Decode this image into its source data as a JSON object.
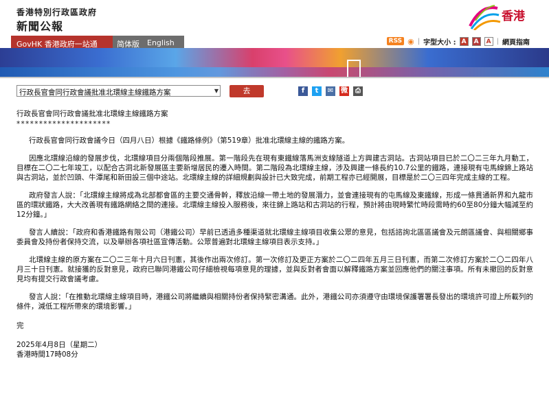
{
  "header": {
    "gov_name": "香港特別行政區政府",
    "site_name": "新聞公報",
    "brand_text": "香港"
  },
  "nav": {
    "govhk": "GovHK 香港政府一站通",
    "simplified": "简体版",
    "english": "English"
  },
  "tools": {
    "rss": "RSS",
    "font_size_label": "字型大小 :",
    "font_small": "A",
    "font_medium": "A",
    "font_large": "A",
    "guide": "網頁指南"
  },
  "selector": {
    "selected": "行政長官會同行政會議批准北環線主線鐵路方案",
    "go_label": "去"
  },
  "share": {
    "facebook": "f",
    "twitter": "t",
    "email": "✉",
    "weibo": "微",
    "print": "⎙"
  },
  "article": {
    "title": "行政長官會同行政會議批准北環線主線鐵路方案",
    "stars": "*********************",
    "paragraphs": [
      "行政長官會同行政會議今日（四月八日）根據《鐵路條例》（第519章）批准北環線主線的鐵路方案。",
      "因應北環線沿線的發展步伐，北環線項目分兩個階段推展。第一階段先在現有東鐵線落馬洲支線隧道上方興建古洞站。古洞站項目已於二〇二三年九月動工，目標在二〇二七年竣工，以配合古洞北新發展區主要新增居民的遷入時間。第二階段為北環線主線，涉及興建一條長約10.7公里的鐵路，連接現有屯馬線錦上路站與古洞站，並於凹頭、牛潭尾和新田設三個中途站。北環線主線的詳細規劃與設計已大致完成，前期工程亦已經開展，目標是於二〇三四年完成主線的工程。",
      "政府發言人說：「北環線主線將成為北部都會區的主要交通骨幹，釋放沿線一帶土地的發展潛力，並會連接現有的屯馬線及東鐵線，形成一條貫通新界和九龍市區的環狀鐵路，大大改善現有鐵路網絡之間的連接。北環線主線投入服務後，來往錦上路站和古洞站的行程，預計將由現時繁忙時段需時約60至80分鐘大幅減至約12分鐘。」",
      "發言人續說：「政府和香港鐵路有限公司（港鐵公司）早前已透過多種渠道就北環線主線項目收集公眾的意見，包括諮詢北區區議會及元朗區議會、與相關鄉事委員會及持份者保持交流，以及舉辦各項社區宣傳活動。公眾普遍對北環線主線項目表示支持。」",
      "北環線主線的原方案在二〇二三年十月六日刊憲，其後作出兩次修訂。第一次修訂及更正方案於二〇二四年五月三日刊憲，而第二次修訂方案於二〇二四年八月三十日刊憲。就接獲的反對意見，政府已聯同港鐵公司仔細檢視每項意見的理據，並與反對者會面以解釋鐵路方案並回應他們的關注事項。所有未撤回的反對意見均有提交行政會議考慮。",
      "發言人說：「在推動北環線主線項目時，港鐵公司將繼續與相關持份者保持緊密溝通。此外，港鐵公司亦須遵守由環境保護署署長發出的環境許可證上所載列的條件，減低工程所帶來的環境影響。」"
    ],
    "end_mark": "完",
    "date": "2025年4月8日（星期二）",
    "time": "香港時間17時08分"
  },
  "colors": {
    "accent_red": "#c0392b",
    "nav_red": "#b5332c",
    "nav_gray": "#6d6d6d"
  }
}
